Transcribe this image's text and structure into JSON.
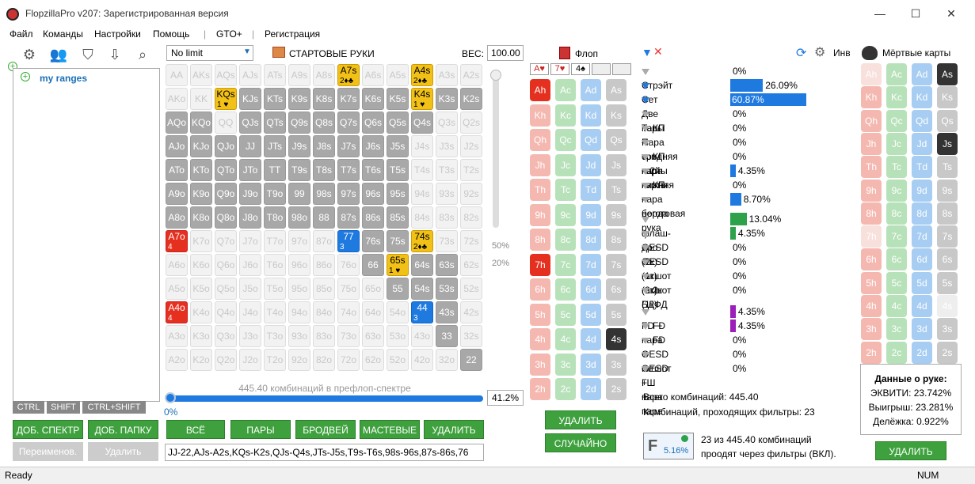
{
  "window": {
    "title": "FlopzillaPro v207: Зарегистрированная версия",
    "minimize": "—",
    "maximize": "☐",
    "close": "✕"
  },
  "menu": [
    "Файл",
    "Команды",
    "Настройки",
    "Помощь",
    "GTO+",
    "Регистрация"
  ],
  "menu_sep": "|",
  "tree": {
    "root_label": "my ranges",
    "plus": "+"
  },
  "key_tabs": [
    "CTRL",
    "SHIFT",
    "CTRL+SHIFT"
  ],
  "left_buttons": {
    "add_spectrum": "ДОБ. СПЕКТР",
    "add_folder": "ДОБ. ПАПКУ",
    "rename": "Переименов.",
    "delete": "Удалить"
  },
  "range_toolbar": {
    "mode": "No limit",
    "start_hands": "СТАРТОВЫЕ РУКИ",
    "weight_label": "ВЕС:",
    "weight_value": "100.00"
  },
  "matrix": {
    "rows": [
      [
        "AA",
        "AKs",
        "AQs",
        "AJs",
        "ATs",
        "A9s",
        "A8s",
        "A7s",
        "A6s",
        "A5s",
        "A4s",
        "A3s",
        "A2s"
      ],
      [
        "AKo",
        "KK",
        "KQs",
        "KJs",
        "KTs",
        "K9s",
        "K8s",
        "K7s",
        "K6s",
        "K5s",
        "K4s",
        "K3s",
        "K2s"
      ],
      [
        "AQo",
        "KQo",
        "QQ",
        "QJs",
        "QTs",
        "Q9s",
        "Q8s",
        "Q7s",
        "Q6s",
        "Q5s",
        "Q4s",
        "Q3s",
        "Q2s"
      ],
      [
        "AJo",
        "KJo",
        "QJo",
        "JJ",
        "JTs",
        "J9s",
        "J8s",
        "J7s",
        "J6s",
        "J5s",
        "J4s",
        "J3s",
        "J2s"
      ],
      [
        "ATo",
        "KTo",
        "QTo",
        "JTo",
        "TT",
        "T9s",
        "T8s",
        "T7s",
        "T6s",
        "T5s",
        "T4s",
        "T3s",
        "T2s"
      ],
      [
        "A9o",
        "K9o",
        "Q9o",
        "J9o",
        "T9o",
        "99",
        "98s",
        "97s",
        "96s",
        "95s",
        "94s",
        "93s",
        "92s"
      ],
      [
        "A8o",
        "K8o",
        "Q8o",
        "J8o",
        "T8o",
        "98o",
        "88",
        "87s",
        "86s",
        "85s",
        "84s",
        "83s",
        "82s"
      ],
      [
        "A7o",
        "K7o",
        "Q7o",
        "J7o",
        "T7o",
        "97o",
        "87o",
        "77",
        "76s",
        "75s",
        "74s",
        "73s",
        "72s"
      ],
      [
        "A6o",
        "K6o",
        "Q6o",
        "J6o",
        "T6o",
        "96o",
        "86o",
        "76o",
        "66",
        "65s",
        "64s",
        "63s",
        "62s"
      ],
      [
        "A5o",
        "K5o",
        "Q5o",
        "J5o",
        "T5o",
        "95o",
        "85o",
        "75o",
        "65o",
        "55",
        "54s",
        "53s",
        "52s"
      ],
      [
        "A4o",
        "K4o",
        "Q4o",
        "J4o",
        "T4o",
        "94o",
        "84o",
        "74o",
        "64o",
        "54o",
        "44",
        "43s",
        "42s"
      ],
      [
        "A3o",
        "K3o",
        "Q3o",
        "J3o",
        "T3o",
        "93o",
        "83o",
        "73o",
        "63o",
        "53o",
        "43o",
        "33",
        "32s"
      ],
      [
        "A2o",
        "K2o",
        "Q2o",
        "J2o",
        "T2o",
        "92o",
        "82o",
        "72o",
        "62o",
        "52o",
        "42o",
        "32o",
        "22"
      ]
    ],
    "states": [
      [
        "l",
        "l",
        "l",
        "l",
        "l",
        "l",
        "l",
        "y",
        "l",
        "l",
        "y",
        "l",
        "l"
      ],
      [
        "l",
        "l",
        "y",
        "g",
        "g",
        "g",
        "g",
        "g",
        "g",
        "g",
        "y",
        "g",
        "g"
      ],
      [
        "g",
        "g",
        "l",
        "g",
        "g",
        "g",
        "g",
        "g",
        "g",
        "g",
        "g",
        "l",
        "l"
      ],
      [
        "g",
        "g",
        "g",
        "g",
        "g",
        "g",
        "g",
        "g",
        "g",
        "g",
        "l",
        "l",
        "l"
      ],
      [
        "g",
        "g",
        "g",
        "g",
        "g",
        "g",
        "g",
        "g",
        "g",
        "g",
        "l",
        "l",
        "l"
      ],
      [
        "g",
        "g",
        "g",
        "g",
        "g",
        "g",
        "g",
        "g",
        "g",
        "g",
        "l",
        "l",
        "l"
      ],
      [
        "g",
        "g",
        "g",
        "g",
        "g",
        "g",
        "g",
        "g",
        "g",
        "g",
        "l",
        "l",
        "l"
      ],
      [
        "r",
        "l",
        "l",
        "l",
        "l",
        "l",
        "l",
        "b",
        "g",
        "g",
        "y",
        "l",
        "l"
      ],
      [
        "l",
        "l",
        "l",
        "l",
        "l",
        "l",
        "l",
        "l",
        "g",
        "y",
        "g",
        "g",
        "l"
      ],
      [
        "l",
        "l",
        "l",
        "l",
        "l",
        "l",
        "l",
        "l",
        "l",
        "g",
        "g",
        "g",
        "l"
      ],
      [
        "r",
        "l",
        "l",
        "l",
        "l",
        "l",
        "l",
        "l",
        "l",
        "l",
        "b",
        "g",
        "l"
      ],
      [
        "l",
        "l",
        "l",
        "l",
        "l",
        "l",
        "l",
        "l",
        "l",
        "l",
        "l",
        "g",
        "l"
      ],
      [
        "l",
        "l",
        "l",
        "l",
        "l",
        "l",
        "l",
        "l",
        "l",
        "l",
        "l",
        "l",
        "g"
      ]
    ],
    "subs": {
      "0-7": "2♦♣",
      "0-10": "2♦♣",
      "1-2": "1 ♥",
      "1-10": "1 ♥",
      "7-0": "4",
      "7-7": "3",
      "7-10": "2♦♣",
      "8-9": "1 ♥",
      "10-0": "4",
      "10-10": "3"
    },
    "slider_marks": [
      "50%",
      "20%"
    ]
  },
  "range_summary": {
    "combos_text": "445.40 комбинаций в префлоп-спектре",
    "zero": "0%",
    "percent": "41.2%",
    "hand_range": "JJ-22,AJs-A2s,KQs-K2s,QJs-Q4s,JTs-J5s,T9s-T6s,98s-96s,87s-86s,76"
  },
  "range_buttons": [
    "ВСЁ",
    "ПАРЫ",
    "БРОДВЕЙ",
    "МАСТЕВЫЕ",
    "УДАЛИТЬ"
  ],
  "flop": {
    "label": "Флоп",
    "cards": [
      "A♥",
      "7♥",
      "4♠",
      "",
      ""
    ],
    "ranks": [
      "A",
      "K",
      "Q",
      "J",
      "T",
      "9",
      "8",
      "7",
      "6",
      "5",
      "4",
      "3",
      "2"
    ],
    "suits": [
      "h",
      "c",
      "d",
      "s"
    ],
    "selected": {
      "Ah": true,
      "7h": true,
      "4s": true
    },
    "delete": "УДАЛИТЬ",
    "random": "СЛУЧАЙНО"
  },
  "stats": {
    "rows1": [
      {
        "label": "Стрэйт",
        "pct": "0%",
        "val": 0,
        "on": false
      },
      {
        "label": "Сет",
        "pct": "26.09%",
        "val": 26.09,
        "on": true
      },
      {
        "label": "Две пары",
        "pct": "60.87%",
        "val": 60.87,
        "on": true
      },
      {
        "label": "Топ-Пара",
        "pct": "0%",
        "val": 0,
        "on": false
      },
      {
        "label": "КП < топ-карты",
        "pct": "0%",
        "val": 0,
        "on": false
      },
      {
        "label": "средняя пара",
        "pct": "0%",
        "val": 0,
        "on": false
      },
      {
        "label": "КП < 2й карты",
        "pct": "0%",
        "val": 0,
        "on": false
      },
      {
        "label": "нижняя пара",
        "pct": "4.35%",
        "val": 4.35,
        "on": false
      },
      {
        "label": "КП < борда",
        "pct": "0%",
        "val": 0,
        "on": false
      },
      {
        "label": "неготовая рука",
        "pct": "8.70%",
        "val": 8.7,
        "on": false
      }
    ],
    "rows2": [
      {
        "label": "флаш-дро",
        "pct": "13.04%",
        "val": 13.04,
        "on": false
      },
      {
        "label": "OESD (2к)",
        "pct": "4.35%",
        "val": 4.35,
        "on": false
      },
      {
        "label": "OESD (1к)",
        "pct": "0%",
        "val": 0,
        "on": false
      },
      {
        "label": "гатшот (2к)",
        "pct": "0%",
        "val": 0,
        "on": false
      },
      {
        "label": "гатшот (1к)",
        "pct": "0%",
        "val": 0,
        "on": false
      },
      {
        "label": "2к БДФД",
        "pct": "0%",
        "val": 0,
        "on": false
      }
    ],
    "rows3": [
      {
        "label": "FD + пара",
        "pct": "4.35%",
        "val": 4.35,
        "on": false
      },
      {
        "label": "FD + OESD",
        "pct": "4.35%",
        "val": 4.35,
        "on": false
      },
      {
        "label": "FD + гатшот",
        "pct": "0%",
        "val": 0,
        "on": false
      },
      {
        "label": "OESD + пара",
        "pct": "0%",
        "val": 0,
        "on": false
      },
      {
        "label": "ГШ + пара",
        "pct": "0%",
        "val": 0,
        "on": false
      }
    ],
    "colors": {
      "made": "#1f7ae0",
      "draw": "#2da24a",
      "combo": "#9b1fb8"
    },
    "total_combos": "Всего комбинаций: 445.40",
    "passing": "Комбинаций, проходящих фильтры: 23",
    "filter_pct": "5.16%",
    "pass_line1": "23 из 445.40 комбинаций",
    "pass_line2": "проодят через фильтры (ВКЛ)."
  },
  "dead": {
    "inv": "Инв",
    "label": "Мёртвые карты",
    "selected": {
      "As": true,
      "Js": true
    },
    "dim": {
      "Ah": true,
      "7h": true,
      "4s": true
    },
    "hand_data": {
      "title": "Данные о руке:",
      "equity": "ЭКВИТИ: 23.742%",
      "win": "Выигрыш: 23.281%",
      "tie": "Делёжка: 0.922%"
    },
    "delete": "УДАЛИТЬ"
  },
  "status": {
    "text": "Ready",
    "num": "NUM"
  }
}
